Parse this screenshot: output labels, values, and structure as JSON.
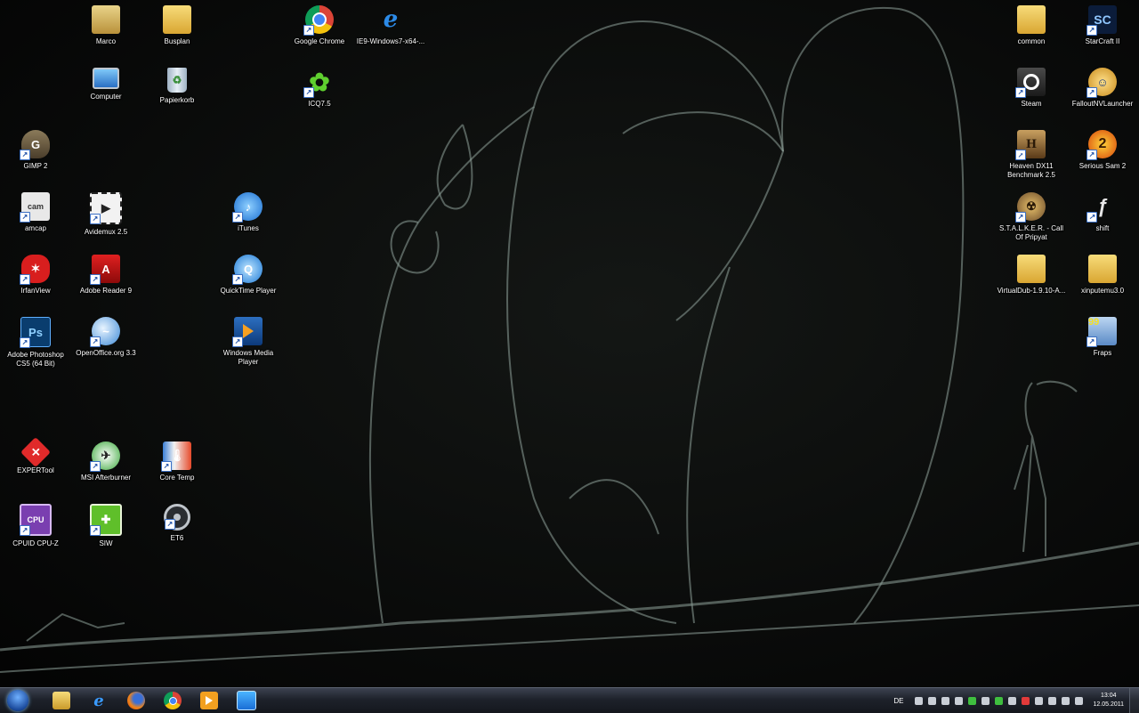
{
  "desktop": {
    "icons": [
      {
        "label": "Marco",
        "icon": "user-folder-icon"
      },
      {
        "label": "Busplan",
        "icon": "folder-icon"
      },
      {
        "label": "Google Chrome",
        "icon": "chrome-icon"
      },
      {
        "label": "IE9-Windows7-x64-...",
        "icon": "internet-explorer-icon"
      },
      {
        "label": "Computer",
        "icon": "computer-icon"
      },
      {
        "label": "Papierkorb",
        "icon": "recycle-bin-icon"
      },
      {
        "label": "ICQ7.5",
        "icon": "icq-icon"
      },
      {
        "label": "GIMP 2",
        "icon": "gimp-icon"
      },
      {
        "label": "amcap",
        "icon": "amcap-icon"
      },
      {
        "label": "Avidemux 2.5",
        "icon": "avidemux-icon"
      },
      {
        "label": "iTunes",
        "icon": "itunes-icon"
      },
      {
        "label": "IrfanView",
        "icon": "irfanview-icon"
      },
      {
        "label": "Adobe Reader 9",
        "icon": "adobe-reader-icon"
      },
      {
        "label": "QuickTime Player",
        "icon": "quicktime-icon"
      },
      {
        "label": "Adobe Photoshop CS5 (64 Bit)",
        "icon": "photoshop-icon"
      },
      {
        "label": "OpenOffice.org 3.3",
        "icon": "openoffice-icon"
      },
      {
        "label": "Windows Media Player",
        "icon": "media-player-icon"
      },
      {
        "label": "EXPERTool",
        "icon": "expertool-icon"
      },
      {
        "label": "MSI Afterburner",
        "icon": "afterburner-icon"
      },
      {
        "label": "Core Temp",
        "icon": "core-temp-icon"
      },
      {
        "label": "CPUID CPU-Z",
        "icon": "cpuz-icon"
      },
      {
        "label": "SIW",
        "icon": "siw-icon"
      },
      {
        "label": "ET6",
        "icon": "et6-icon"
      },
      {
        "label": "common",
        "icon": "folder-icon"
      },
      {
        "label": "StarCraft II",
        "icon": "starcraft-icon"
      },
      {
        "label": "Steam",
        "icon": "steam-icon"
      },
      {
        "label": "FalloutNVLauncher",
        "icon": "fallout-icon"
      },
      {
        "label": "Heaven DX11 Benchmark 2.5",
        "icon": "heaven-benchmark-icon"
      },
      {
        "label": "Serious Sam 2",
        "icon": "serious-sam-icon"
      },
      {
        "label": "S.T.A.L.K.E.R. - Call Of Pripyat",
        "icon": "stalker-icon"
      },
      {
        "label": "shift",
        "icon": "shift-icon"
      },
      {
        "label": "VirtualDub-1.9.10-A...",
        "icon": "folder-icon"
      },
      {
        "label": "xinputemu3.0",
        "icon": "folder-icon"
      },
      {
        "label": "Fraps",
        "icon": "fraps-icon"
      }
    ]
  },
  "taskbar": {
    "pinned": [
      {
        "icon": "explorer-icon"
      },
      {
        "icon": "internet-explorer-icon"
      },
      {
        "icon": "firefox-icon"
      },
      {
        "icon": "chrome-icon"
      },
      {
        "icon": "media-player-icon"
      },
      {
        "icon": "app-icon"
      }
    ],
    "tray": {
      "language": "DE",
      "time": "13:04",
      "date": "12.05.2011"
    }
  }
}
